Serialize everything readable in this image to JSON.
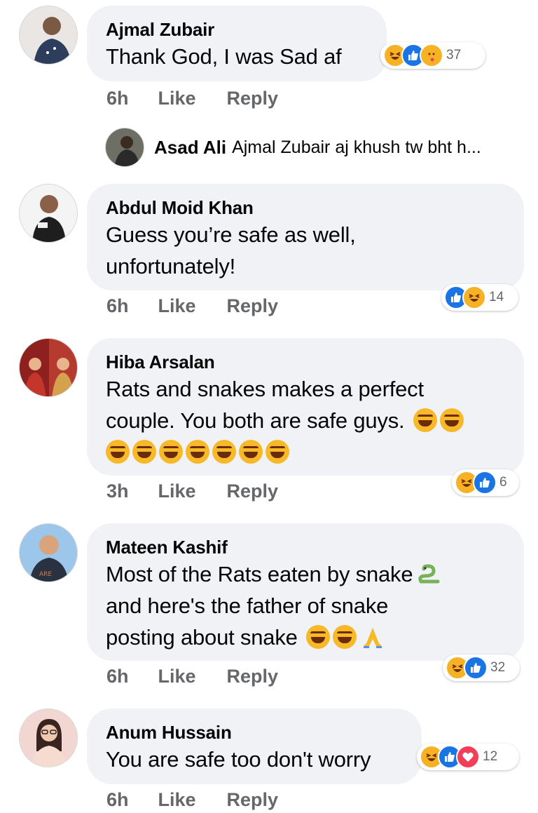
{
  "comments": [
    {
      "name": "Ajmal Zubair",
      "lines": [
        "Thank God, I was Sad af"
      ],
      "time": "6h",
      "like": "Like",
      "reply": "Reply",
      "reactions": {
        "icons": [
          "haha",
          "like",
          "care"
        ],
        "count": "37"
      },
      "avatar_color": "#3a4b6a"
    },
    {
      "name": "Abdul Moid Khan",
      "lines": [
        "Guess you’re safe as well,",
        "unfortunately!"
      ],
      "time": "6h",
      "like": "Like",
      "reply": "Reply",
      "reactions": {
        "icons": [
          "like",
          "haha"
        ],
        "count": "14"
      },
      "avatar_color": "#333333"
    },
    {
      "name": "Hiba Arsalan",
      "lines": [
        "Rats and snakes makes a perfect",
        "couple. You both are safe guys."
      ],
      "time": "3h",
      "like": "Like",
      "reply": "Reply",
      "reactions": {
        "icons": [
          "haha",
          "like"
        ],
        "count": "6"
      },
      "avatar_color": "#a3262a"
    },
    {
      "name": "Mateen Kashif",
      "lines": [
        "Most of the Rats eaten by snake",
        "and here's the father of snake",
        "posting about snake"
      ],
      "time": "6h",
      "like": "Like",
      "reply": "Reply",
      "reactions": {
        "icons": [
          "haha",
          "like"
        ],
        "count": "32"
      },
      "avatar_color": "#5b8fc9"
    },
    {
      "name": "Anum Hussain",
      "lines": [
        "You are safe too don't worry"
      ],
      "time": "6h",
      "like": "Like",
      "reply": "Reply",
      "reactions": {
        "icons": [
          "haha",
          "like",
          "love"
        ],
        "count": "12"
      },
      "avatar_color": "#e8b4b0"
    }
  ],
  "reply_preview": {
    "name": "Asad Ali",
    "text": "Ajmal Zubair aj khush tw bht h..."
  },
  "colors": {
    "bubble": "#f0f2f5",
    "secondary_text": "#65676b",
    "like_blue": "#1b74e4",
    "haha_yellow": "#f7b125",
    "love_red": "#f33e58"
  }
}
